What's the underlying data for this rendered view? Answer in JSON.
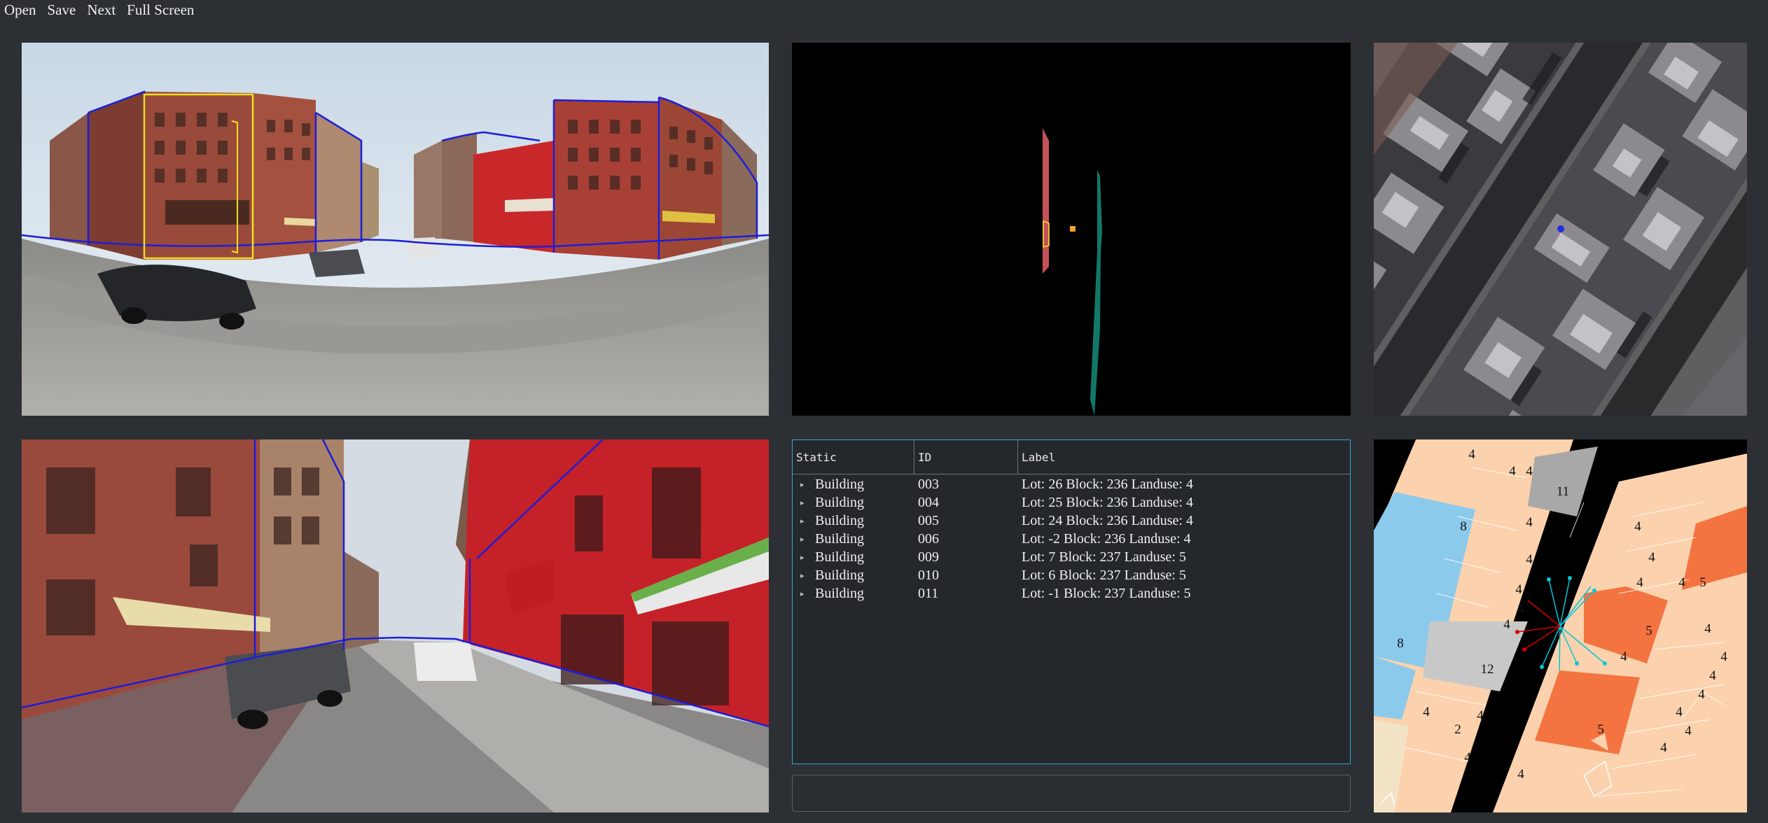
{
  "menu": {
    "items": [
      "Open",
      "Save",
      "Next",
      "Full Screen"
    ]
  },
  "panels": {
    "panorama": "Street-level panorama with building outlines",
    "perspective": "Perspective street view with building outlines",
    "topdown": "Projected building footprints",
    "satellite": "Satellite imagery",
    "map": "Tax lot map"
  },
  "tree": {
    "headers": [
      "Static",
      "ID",
      "Label"
    ],
    "rows": [
      {
        "static": "Building",
        "id": "003",
        "label": "Lot: 26 Block: 236 Landuse: 4"
      },
      {
        "static": "Building",
        "id": "004",
        "label": "Lot: 25 Block: 236 Landuse: 4"
      },
      {
        "static": "Building",
        "id": "005",
        "label": "Lot: 24 Block: 236 Landuse: 4"
      },
      {
        "static": "Building",
        "id": "006",
        "label": "Lot: -2 Block: 236 Landuse: 4"
      },
      {
        "static": "Building",
        "id": "009",
        "label": "Lot: 7 Block: 237 Landuse: 5"
      },
      {
        "static": "Building",
        "id": "010",
        "label": "Lot: 6 Block: 237 Landuse: 5"
      },
      {
        "static": "Building",
        "id": "011",
        "label": "Lot: -1 Block: 237 Landuse: 5"
      }
    ]
  },
  "map_labels": [
    "4",
    "4",
    "4",
    "11",
    "8",
    "4",
    "4",
    "4",
    "4",
    "4",
    "4",
    "5",
    "4",
    "4",
    "5",
    "4",
    "8",
    "12",
    "4",
    "4",
    "4",
    "4",
    "2",
    "4",
    "4",
    "4",
    "5",
    "4",
    "4",
    "4",
    "4",
    "4"
  ],
  "colors": {
    "outline": "#1d1dd8",
    "selected": "#f0e020",
    "residential": "#fbd2ad",
    "commercial": "#f37440",
    "park": "#8ccaec",
    "other": "#bcbcbc",
    "accent": "#3aa6d8"
  }
}
